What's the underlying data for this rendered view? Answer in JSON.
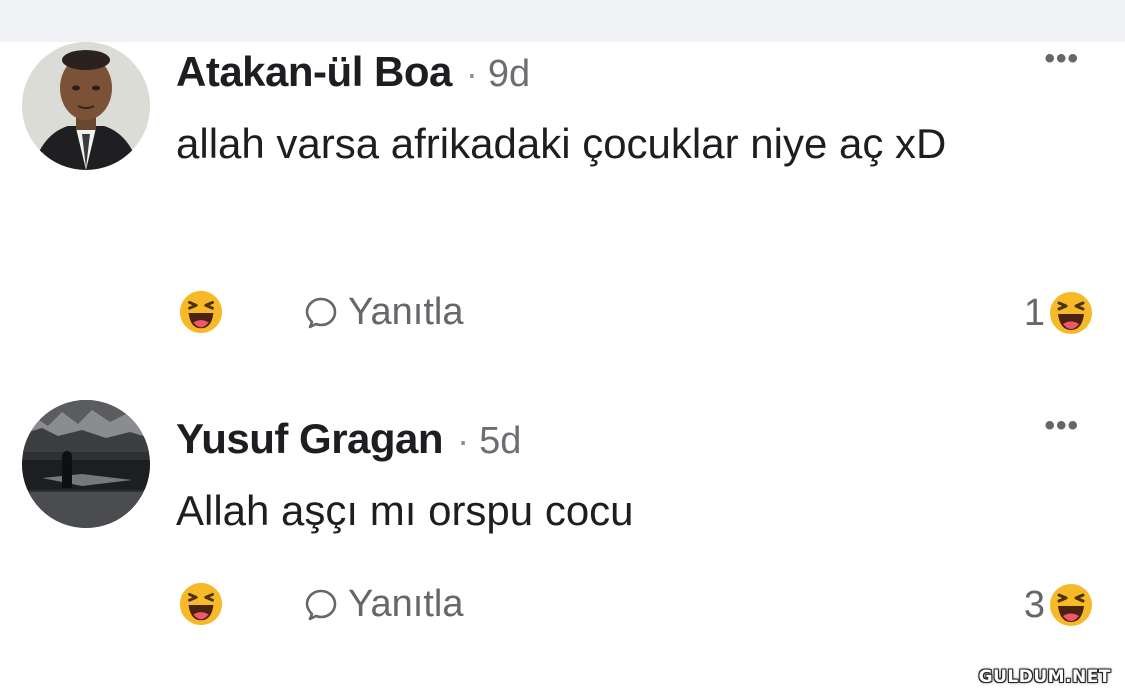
{
  "comments": [
    {
      "author": "Atakan-ül Boa",
      "separator": "·",
      "time": "9d",
      "more": "•••",
      "text": "allah varsa afrikadaki çocuklar niye aç xD",
      "reply_label": "Yanıtla",
      "reaction_count": "1",
      "reaction_icon": "haha-emoji",
      "avatar": "man-in-suit-photo"
    },
    {
      "author": "Yusuf Gragan",
      "separator": "·",
      "time": "5d",
      "more": "•••",
      "text": "Allah aşçı mı orspu cocu",
      "reply_label": "Yanıtla",
      "reaction_count": "3",
      "reaction_icon": "haha-emoji",
      "avatar": "dark-landscape-photo"
    }
  ],
  "watermark": "GULDUM.NET",
  "colors": {
    "text": "#1c1e21",
    "muted": "#65676b",
    "haha_yellow": "#f7b928",
    "background_strip": "#f0f2f5"
  }
}
